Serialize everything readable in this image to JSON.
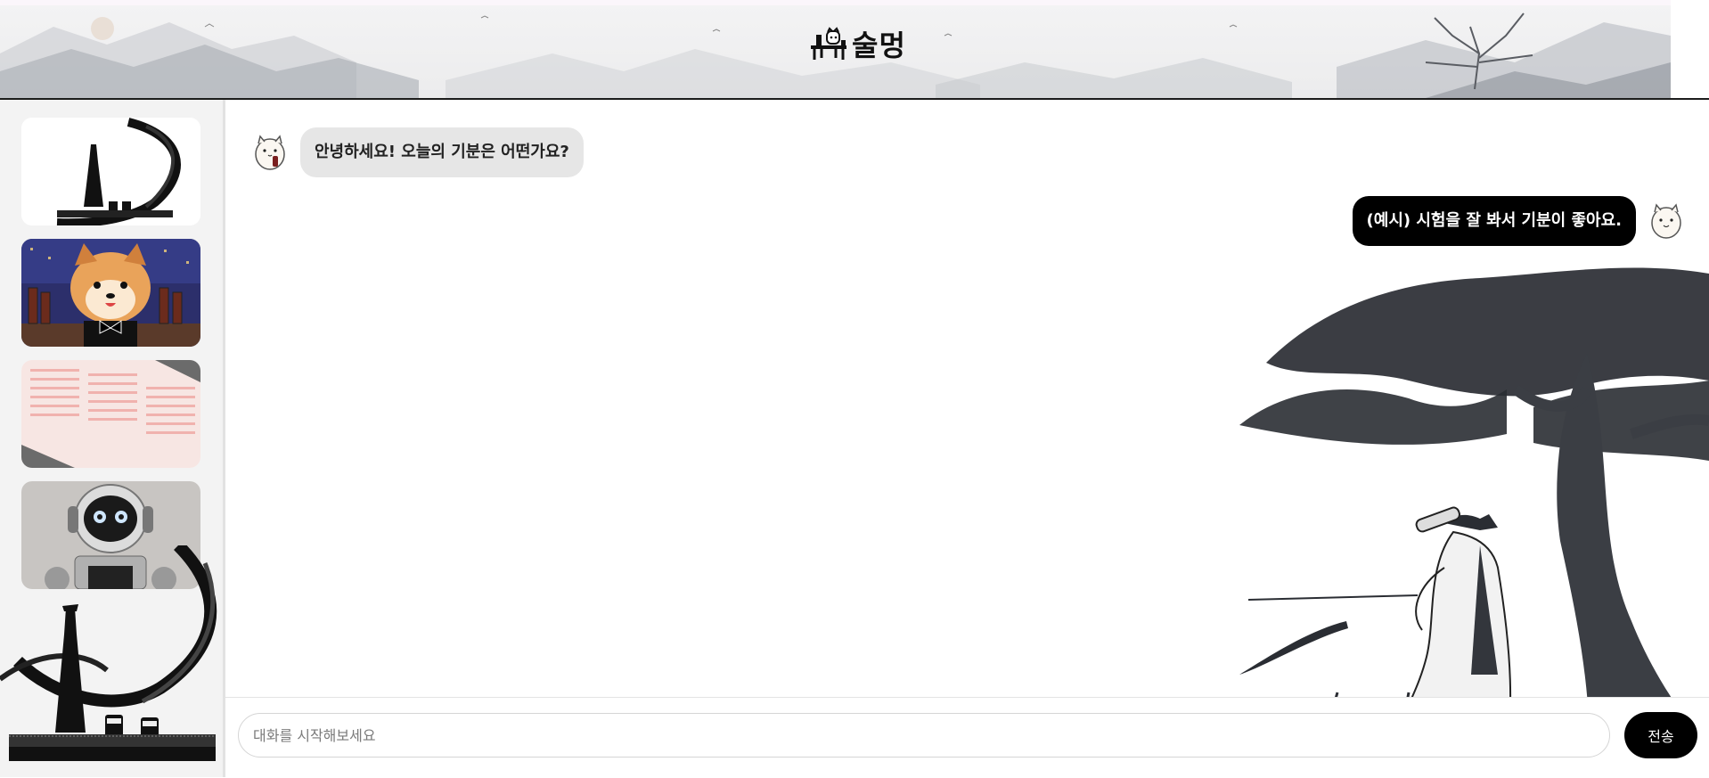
{
  "header": {
    "title": "술멍",
    "logo_icon": "cat-bottle-logo-icon"
  },
  "sidebar": {
    "cards": [
      {
        "name": "ink-bottle-card",
        "icon": "ink-bottle-image"
      },
      {
        "name": "pixel-dog-bartender-card",
        "icon": "pixel-dog-image"
      },
      {
        "name": "test-sheet-card",
        "icon": "answer-sheet-image"
      },
      {
        "name": "robot-card",
        "icon": "robot-image"
      }
    ]
  },
  "chat": {
    "messages": [
      {
        "role": "bot",
        "text": "안녕하세요! 오늘의 기분은 어떤가요?"
      },
      {
        "role": "user",
        "text": "(예시) 시험을 잘 봐서 기분이 좋아요."
      }
    ]
  },
  "composer": {
    "placeholder": "대화를 시작해보세요",
    "value": "",
    "send_label": "전송"
  },
  "colors": {
    "accent": "#000000",
    "bot_bubble": "#e6e6e6",
    "sidebar_bg": "#f3f3f3"
  }
}
